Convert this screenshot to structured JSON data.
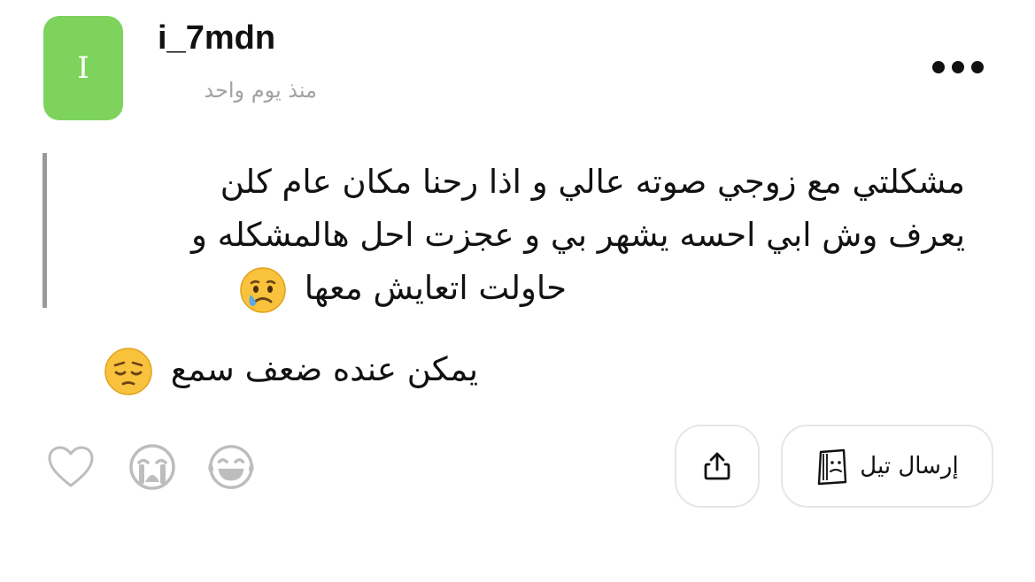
{
  "post": {
    "avatar_initial": "I",
    "avatar_color": "#7dd35b",
    "username": "i_7mdn",
    "timestamp": "منذ يوم واحد",
    "more_menu_icon": "more-horizontal-icon"
  },
  "quote": {
    "lines": [
      "مشكلتي مع زوجي صوته عالي و اذا رحنا مكان عام كلن",
      "يعرف وش ابي احسه يشهر بي و عجزت احل هالمشكله و",
      "حاولت اتعايش معها"
    ],
    "trailing_emoji": "crying-face-emoji"
  },
  "comment": {
    "text": "يمكن عنده ضعف سمع",
    "trailing_emoji": "pensive-face-emoji"
  },
  "actions": {
    "send_label": "إرسال تيل",
    "send_icon": "tell-bag-icon",
    "share_icon": "share-icon",
    "reactions": [
      "heart-icon",
      "sobbing-face-icon",
      "laughing-face-icon"
    ]
  },
  "colors": {
    "accent_green": "#7dd35b",
    "muted_text": "#a3a3a3",
    "quote_bar": "#9a9a9a",
    "icon_gray": "#bdbdbd",
    "border": "#e6e6e6"
  }
}
